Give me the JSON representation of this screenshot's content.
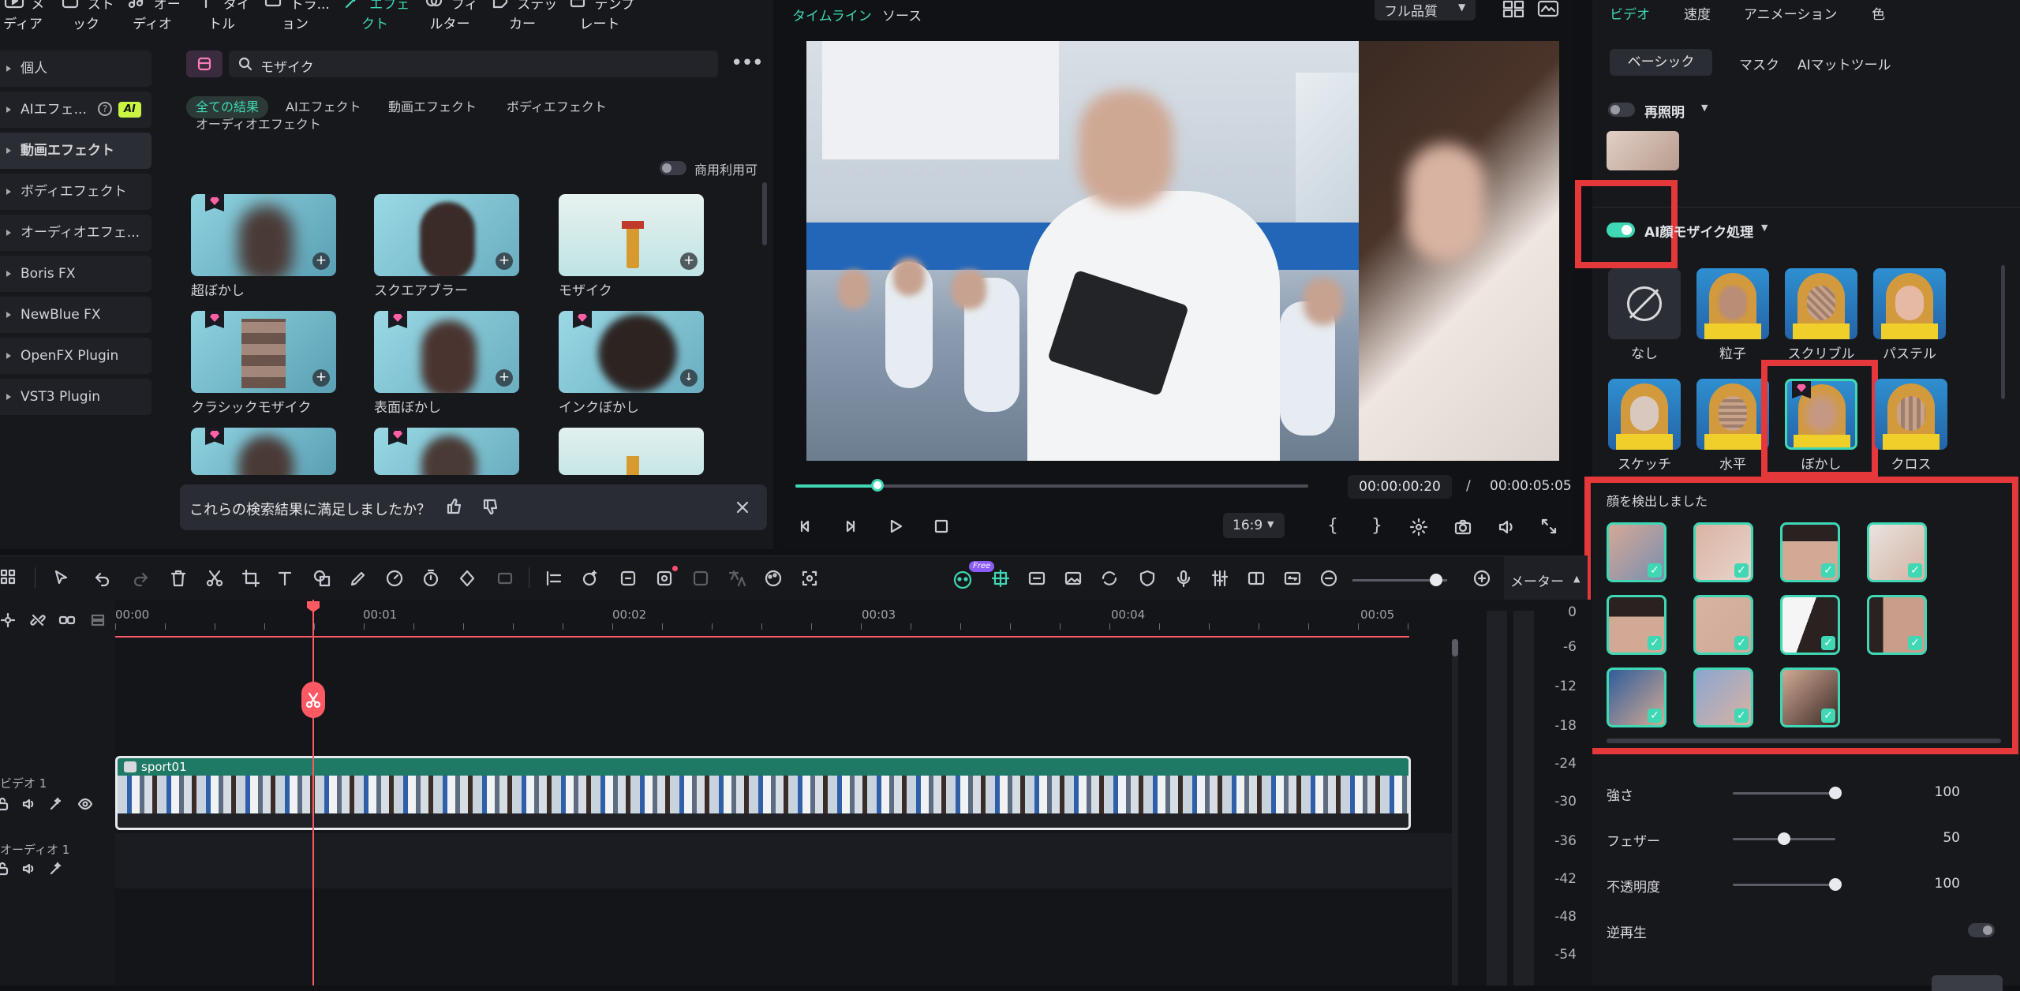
{
  "toolbar": {
    "items": [
      "メディア",
      "ストック",
      "オーディオ",
      "タイトル",
      "トラ...ョン",
      "エフェクト",
      "フィルター",
      "ステッカー",
      "テンプレート"
    ]
  },
  "sidebar": {
    "items": [
      "個人",
      "AIエフェ...",
      "動画エフェクト",
      "ボディエフェクト",
      "オーディオエフェ...",
      "Boris FX",
      "NewBlue FX",
      "OpenFX Plugin",
      "VST3 Plugin"
    ],
    "ai_badge": "AI"
  },
  "search": {
    "value": "モザイク"
  },
  "filters": {
    "tabs": [
      "全ての結果",
      "AIエフェクト",
      "動画エフェクト",
      "ボディエフェクト",
      "オーディオエフェクト"
    ],
    "commercial_label": "商用利用可"
  },
  "effects": [
    {
      "label": "超ぼかし"
    },
    {
      "label": "スクエアブラー"
    },
    {
      "label": "モザイク"
    },
    {
      "label": "クラシックモザイク"
    },
    {
      "label": "表面ぼかし"
    },
    {
      "label": "インクぼかし"
    }
  ],
  "feedback": {
    "question": "これらの検索結果に満足しましたか？"
  },
  "preview": {
    "tab_timeline": "タイムライン",
    "tab_source": "ソース",
    "quality": "フル品質",
    "current_time": "00:00:00:20",
    "separator": "/",
    "total_time": "00:00:05:05",
    "aspect": "16:9",
    "progress": 0.16,
    "mark_in": "{",
    "mark_out": "}"
  },
  "inspector": {
    "top_tabs": [
      "ビデオ",
      "速度",
      "アニメーション",
      "色"
    ],
    "sub_tabs": [
      "ベーシック",
      "マスク",
      "AIマットツール"
    ],
    "relight_label": "再照明",
    "ai_face_label": "AI顔モザイク処理",
    "styles_row1": [
      "なし",
      "粒子",
      "スクリブル",
      "パステル"
    ],
    "styles_row2": [
      "スケッチ",
      "水平",
      "ぼかし",
      "クロス"
    ],
    "faces_detected": "顔を検出しました",
    "sliders": [
      {
        "label": "強さ",
        "value": "100",
        "level": 1.0
      },
      {
        "label": "フェザー",
        "value": "50",
        "level": 0.5
      },
      {
        "label": "不透明度",
        "value": "100",
        "level": 1.0
      }
    ],
    "reverse_label": "逆再生"
  },
  "timeline": {
    "ruler": [
      "00:00",
      "00:01",
      "00:02",
      "00:03",
      "00:04",
      "00:05"
    ],
    "clip_name": "sport01",
    "video_track": "ビデオ 1",
    "audio_track": "オーディオ 1",
    "meter_label": "メーター",
    "meter_marks": [
      "0",
      "-6",
      "-12",
      "-18",
      "-24",
      "-30",
      "-36",
      "-42",
      "-48",
      "-54"
    ],
    "ai_badge": "Free"
  },
  "colors": {
    "accent": "#3fd7b4",
    "highlight": "#e5383b",
    "playhead": "#ff5a64"
  }
}
